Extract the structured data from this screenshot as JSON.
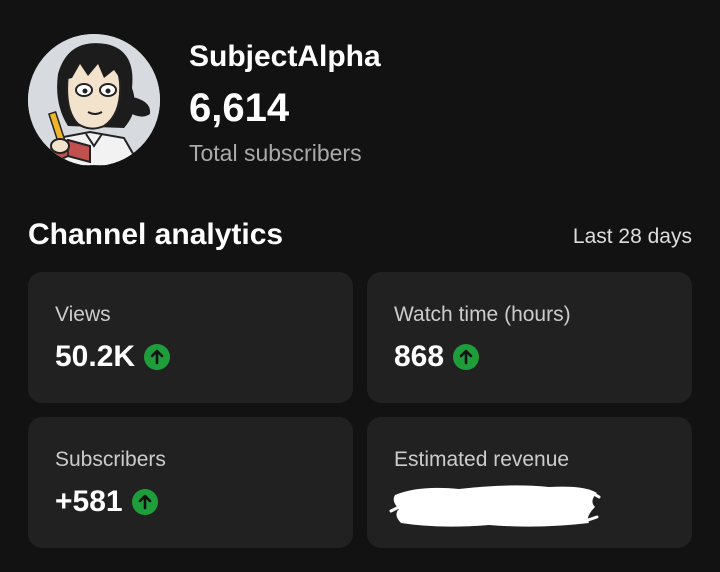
{
  "channel": {
    "name": "SubjectAlpha",
    "subscriber_count": "6,614",
    "subscriber_label": "Total subscribers",
    "avatar_icon": "cartoon-avatar"
  },
  "analytics": {
    "title": "Channel analytics",
    "period": "Last 28 days",
    "trend_color": "#1e9e3a",
    "cards": [
      {
        "label": "Views",
        "value": "50.2K",
        "trend": "up"
      },
      {
        "label": "Watch time (hours)",
        "value": "868",
        "trend": "up"
      },
      {
        "label": "Subscribers",
        "value": "+581",
        "trend": "up"
      },
      {
        "label": "Estimated revenue",
        "value": "",
        "redacted": true
      }
    ]
  }
}
